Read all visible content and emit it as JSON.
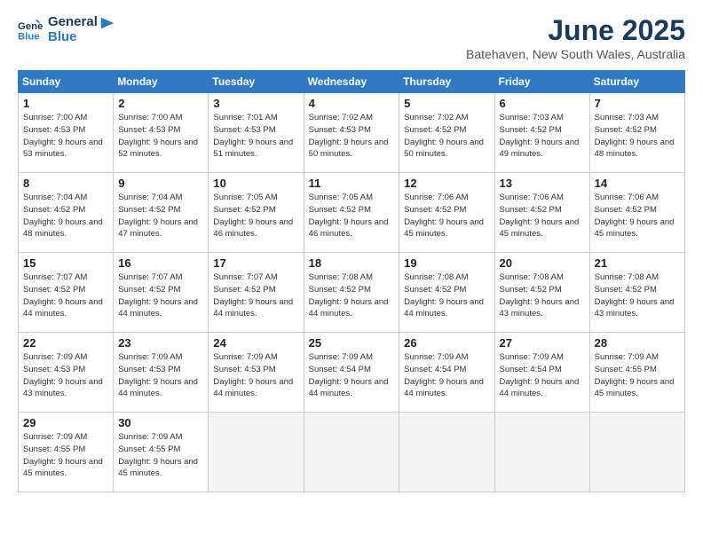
{
  "logo": {
    "line1": "General",
    "line2": "Blue"
  },
  "title": "June 2025",
  "subtitle": "Batehaven, New South Wales, Australia",
  "days_of_week": [
    "Sunday",
    "Monday",
    "Tuesday",
    "Wednesday",
    "Thursday",
    "Friday",
    "Saturday"
  ],
  "weeks": [
    [
      {
        "day": 1,
        "sunrise": "7:00 AM",
        "sunset": "4:53 PM",
        "daylight": "9 hours and 53 minutes"
      },
      {
        "day": 2,
        "sunrise": "7:00 AM",
        "sunset": "4:53 PM",
        "daylight": "9 hours and 52 minutes"
      },
      {
        "day": 3,
        "sunrise": "7:01 AM",
        "sunset": "4:53 PM",
        "daylight": "9 hours and 51 minutes"
      },
      {
        "day": 4,
        "sunrise": "7:02 AM",
        "sunset": "4:53 PM",
        "daylight": "9 hours and 50 minutes"
      },
      {
        "day": 5,
        "sunrise": "7:02 AM",
        "sunset": "4:52 PM",
        "daylight": "9 hours and 50 minutes"
      },
      {
        "day": 6,
        "sunrise": "7:03 AM",
        "sunset": "4:52 PM",
        "daylight": "9 hours and 49 minutes"
      },
      {
        "day": 7,
        "sunrise": "7:03 AM",
        "sunset": "4:52 PM",
        "daylight": "9 hours and 48 minutes"
      }
    ],
    [
      {
        "day": 8,
        "sunrise": "7:04 AM",
        "sunset": "4:52 PM",
        "daylight": "9 hours and 48 minutes"
      },
      {
        "day": 9,
        "sunrise": "7:04 AM",
        "sunset": "4:52 PM",
        "daylight": "9 hours and 47 minutes"
      },
      {
        "day": 10,
        "sunrise": "7:05 AM",
        "sunset": "4:52 PM",
        "daylight": "9 hours and 46 minutes"
      },
      {
        "day": 11,
        "sunrise": "7:05 AM",
        "sunset": "4:52 PM",
        "daylight": "9 hours and 46 minutes"
      },
      {
        "day": 12,
        "sunrise": "7:06 AM",
        "sunset": "4:52 PM",
        "daylight": "9 hours and 45 minutes"
      },
      {
        "day": 13,
        "sunrise": "7:06 AM",
        "sunset": "4:52 PM",
        "daylight": "9 hours and 45 minutes"
      },
      {
        "day": 14,
        "sunrise": "7:06 AM",
        "sunset": "4:52 PM",
        "daylight": "9 hours and 45 minutes"
      }
    ],
    [
      {
        "day": 15,
        "sunrise": "7:07 AM",
        "sunset": "4:52 PM",
        "daylight": "9 hours and 44 minutes"
      },
      {
        "day": 16,
        "sunrise": "7:07 AM",
        "sunset": "4:52 PM",
        "daylight": "9 hours and 44 minutes"
      },
      {
        "day": 17,
        "sunrise": "7:07 AM",
        "sunset": "4:52 PM",
        "daylight": "9 hours and 44 minutes"
      },
      {
        "day": 18,
        "sunrise": "7:08 AM",
        "sunset": "4:52 PM",
        "daylight": "9 hours and 44 minutes"
      },
      {
        "day": 19,
        "sunrise": "7:08 AM",
        "sunset": "4:52 PM",
        "daylight": "9 hours and 44 minutes"
      },
      {
        "day": 20,
        "sunrise": "7:08 AM",
        "sunset": "4:52 PM",
        "daylight": "9 hours and 43 minutes"
      },
      {
        "day": 21,
        "sunrise": "7:08 AM",
        "sunset": "4:52 PM",
        "daylight": "9 hours and 43 minutes"
      }
    ],
    [
      {
        "day": 22,
        "sunrise": "7:09 AM",
        "sunset": "4:53 PM",
        "daylight": "9 hours and 43 minutes"
      },
      {
        "day": 23,
        "sunrise": "7:09 AM",
        "sunset": "4:53 PM",
        "daylight": "9 hours and 44 minutes"
      },
      {
        "day": 24,
        "sunrise": "7:09 AM",
        "sunset": "4:53 PM",
        "daylight": "9 hours and 44 minutes"
      },
      {
        "day": 25,
        "sunrise": "7:09 AM",
        "sunset": "4:54 PM",
        "daylight": "9 hours and 44 minutes"
      },
      {
        "day": 26,
        "sunrise": "7:09 AM",
        "sunset": "4:54 PM",
        "daylight": "9 hours and 44 minutes"
      },
      {
        "day": 27,
        "sunrise": "7:09 AM",
        "sunset": "4:54 PM",
        "daylight": "9 hours and 44 minutes"
      },
      {
        "day": 28,
        "sunrise": "7:09 AM",
        "sunset": "4:55 PM",
        "daylight": "9 hours and 45 minutes"
      }
    ],
    [
      {
        "day": 29,
        "sunrise": "7:09 AM",
        "sunset": "4:55 PM",
        "daylight": "9 hours and 45 minutes"
      },
      {
        "day": 30,
        "sunrise": "7:09 AM",
        "sunset": "4:55 PM",
        "daylight": "9 hours and 45 minutes"
      },
      null,
      null,
      null,
      null,
      null
    ]
  ]
}
